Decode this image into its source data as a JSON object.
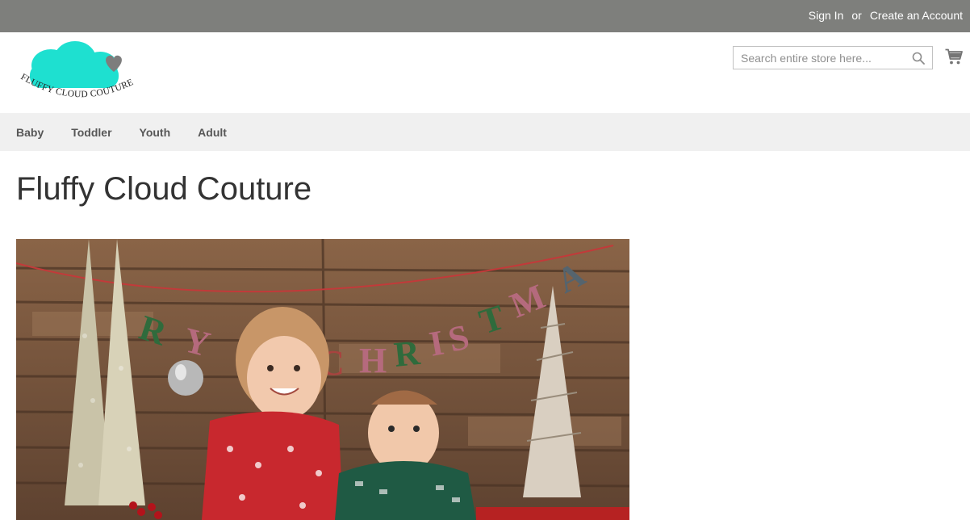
{
  "topbar": {
    "sign_in": "Sign In",
    "separator": "or",
    "create_account": "Create an Account"
  },
  "header": {
    "logo_text": "FLUFFY CLOUD COUTURE",
    "search_placeholder": "Search entire store here...",
    "search_icon": "search-icon",
    "cart_icon": "cart-icon"
  },
  "nav": {
    "items": [
      {
        "label": "Baby"
      },
      {
        "label": "Toddler"
      },
      {
        "label": "Youth"
      },
      {
        "label": "Adult"
      }
    ]
  },
  "main": {
    "title": "Fluffy Cloud Couture",
    "hero_banner_letters": "RY CHRISTMA"
  },
  "colors": {
    "topbar": "#7e7f7c",
    "nav_bg": "#f0f0f0",
    "logo_cloud": "#1ee0d0",
    "logo_heart": "#7d7d7d"
  }
}
